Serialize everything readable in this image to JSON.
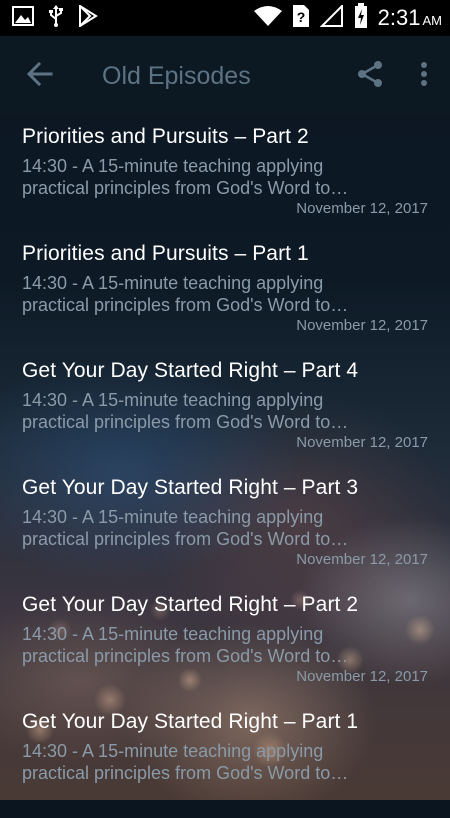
{
  "status_bar": {
    "time": "2:31",
    "ampm": "AM",
    "left_icons": [
      "image-icon",
      "usb-icon",
      "play-store-icon"
    ],
    "right_icons": [
      "wifi-icon",
      "sim-unknown-icon",
      "cell-signal-icon",
      "battery-charging-icon"
    ]
  },
  "app_bar": {
    "title": "Old Episodes",
    "back_icon": "arrow-back-icon",
    "share_icon": "share-icon",
    "more_icon": "more-vert-icon",
    "title_color": "#5d7383"
  },
  "episodes": [
    {
      "title": "Priorities and Pursuits – Part 2",
      "desc_line1": "14:30 - A 15-minute teaching applying",
      "desc_line2": "practical principles from God's Word to…",
      "date": "November 12, 2017"
    },
    {
      "title": "Priorities and Pursuits – Part 1",
      "desc_line1": "14:30 - A 15-minute teaching applying",
      "desc_line2": "practical principles from God's Word to…",
      "date": "November 12, 2017"
    },
    {
      "title": "Get Your Day Started Right – Part 4",
      "desc_line1": "14:30 - A 15-minute teaching applying",
      "desc_line2": "practical principles from God's Word to…",
      "date": "November 12, 2017"
    },
    {
      "title": "Get Your Day Started Right – Part 3",
      "desc_line1": "14:30 - A 15-minute teaching applying",
      "desc_line2": "practical principles from God's Word to…",
      "date": "November 12, 2017"
    },
    {
      "title": "Get Your Day Started Right – Part 2",
      "desc_line1": "14:30 - A 15-minute teaching applying",
      "desc_line2": "practical principles from God's Word to…",
      "date": "November 12, 2017"
    },
    {
      "title": "Get Your Day Started Right – Part 1",
      "desc_line1": "14:30 - A 15-minute teaching applying",
      "desc_line2": "practical principles from God's Word to…",
      "date": ""
    }
  ]
}
